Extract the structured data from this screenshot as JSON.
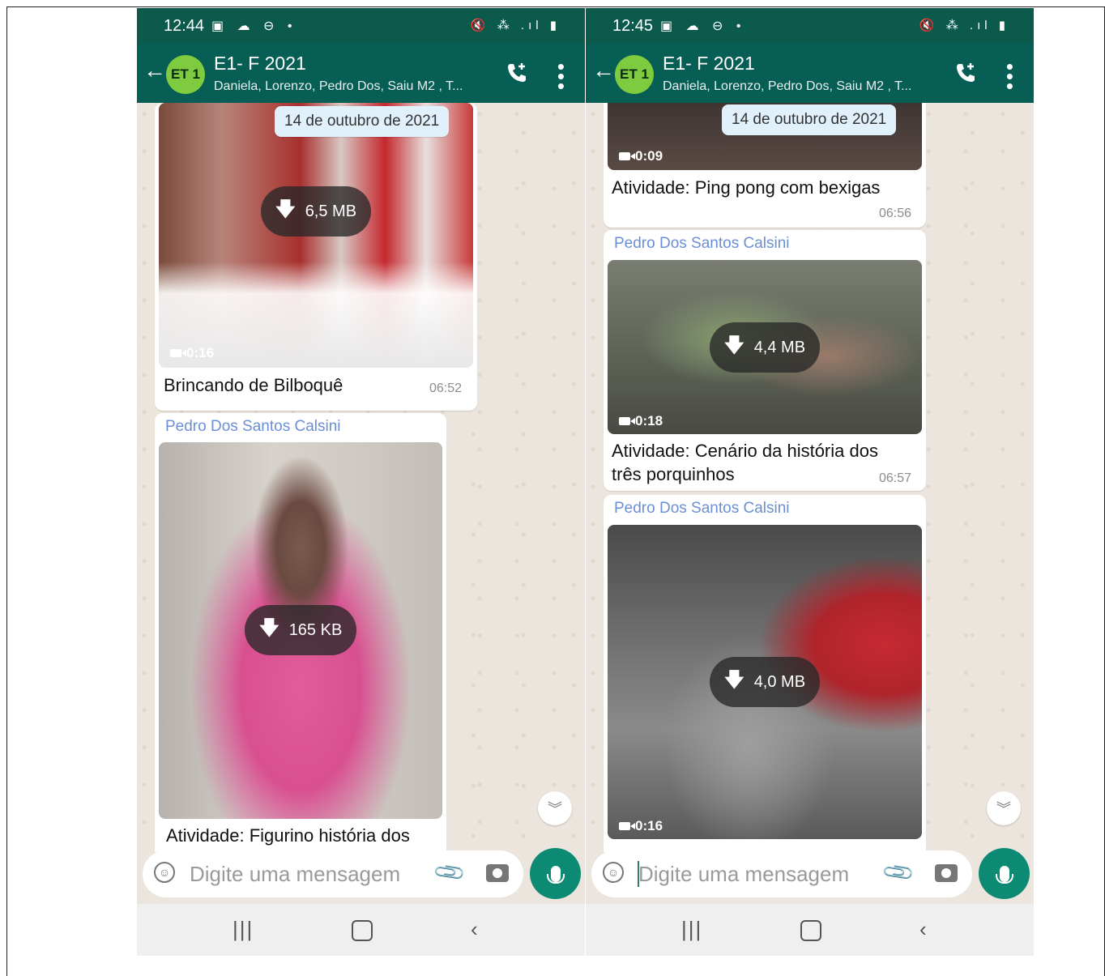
{
  "left": {
    "status": {
      "time": "12:44",
      "icons": "▣ ☁ ⊖ •",
      "right_icons": "🔇 ⁂ .ıl ▮"
    },
    "header": {
      "title": "E1- F 2021",
      "avatar": "ET 1",
      "subtitle": "Daniela, Lorenzo, Pedro Dos, Saiu M2 , T..."
    },
    "date_chip": "14 de outubro de 2021",
    "messages": [
      {
        "size": "6,5 MB",
        "duration": "0:16",
        "caption": "Brincando de Bilboquê",
        "time": "06:52"
      },
      {
        "sender": "Pedro Dos Santos Calsini",
        "size": "165 KB",
        "caption": "Atividade: Figurino história dos"
      }
    ],
    "input": {
      "placeholder": "Digite uma mensagem"
    }
  },
  "right": {
    "status": {
      "time": "12:45",
      "icons": "▣ ☁ ⊖ •",
      "right_icons": "🔇 ⁂ .ıl ▮"
    },
    "header": {
      "title": "E1- F 2021",
      "avatar": "ET 1",
      "subtitle": "Daniela, Lorenzo, Pedro Dos, Saiu M2 , T..."
    },
    "date_chip": "14 de outubro de 2021",
    "messages": [
      {
        "duration": "0:09",
        "caption": "Atividade: Ping pong com bexigas",
        "time": "06:56"
      },
      {
        "sender": "Pedro Dos Santos Calsini",
        "size": "4,4 MB",
        "duration": "0:18",
        "caption_line1": "Atividade: Cenário da história dos",
        "caption_line2": "três porquinhos",
        "time": "06:57"
      },
      {
        "sender": "Pedro Dos Santos Calsini",
        "size": "4,0 MB",
        "duration": "0:16"
      }
    ],
    "input": {
      "placeholder": "Digite uma mensagem"
    }
  },
  "icons": {
    "back": "←",
    "call": "call-add-icon",
    "menu": "⋮",
    "download": "🡇",
    "scroll_down": "︾",
    "nav_recent": "|||",
    "nav_back": "‹"
  }
}
